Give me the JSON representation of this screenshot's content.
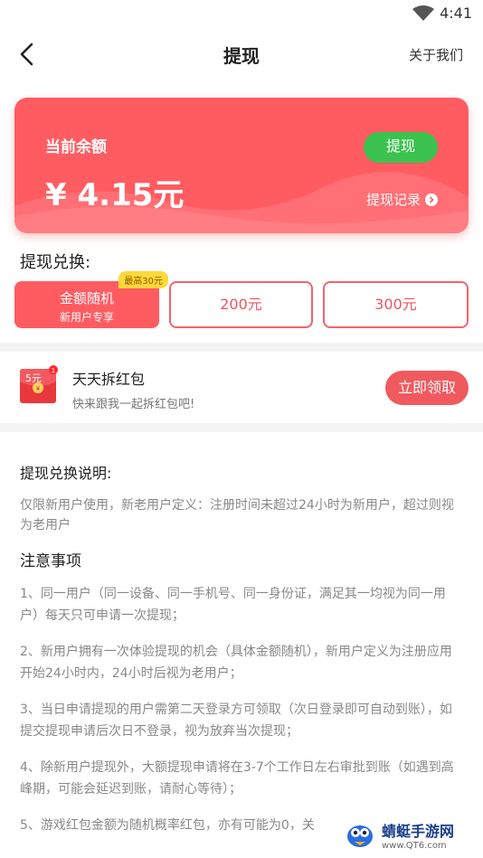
{
  "status_bar": {
    "time": "4:41"
  },
  "nav": {
    "title": "提现",
    "right_link": "关于我们"
  },
  "balance": {
    "label": "当前余额",
    "amount": "¥ 4.15元",
    "withdraw_button": "提现",
    "records_link": "提现记录",
    "colors": {
      "card": "#ff5c62",
      "button": "#3cc24e"
    }
  },
  "exchange": {
    "title": "提现兑换:",
    "options": [
      {
        "main": "金额随机",
        "sub": "新用户专享",
        "tag": "最高30元",
        "selected": true
      },
      {
        "main": "200元"
      },
      {
        "main": "300元"
      }
    ]
  },
  "redpack": {
    "icon_text": "5元",
    "badge": "1",
    "name": "天天拆红包",
    "desc": "快来跟我一起拆红包吧!",
    "claim_button": "立即领取"
  },
  "instructions": {
    "title": "提现兑换说明:",
    "intro": "仅限新用户使用，新老用户定义：注册时间未超过24小时为新用户，超过则视为老用户",
    "notes_title": "注意事项",
    "rules": [
      "1、同一用户（同一设备、同一手机号、同一身份证，满足其一均视为同一用户）每天只可申请一次提现；",
      "2、新用户拥有一次体验提现的机会（具体金额随机），新用户定义为注册应用开始24小时内，24小时后视为老用户；",
      "3、当日申请提现的用户需第二天登录方可领取（次日登录即可自动到账），如提交提现申请后次日不登录，视为放弃当次提现；",
      "4、除新用户提现外，大额提现申请将在3-7个工作日左右审批到账（如遇到高峰期，可能会延迟到账，请耐心等待）；",
      "5、游戏红包金额为随机概率红包，亦有可能为0，关"
    ]
  },
  "watermark": {
    "name": "蜻蜓手游网",
    "url": "www.QT6.com"
  }
}
